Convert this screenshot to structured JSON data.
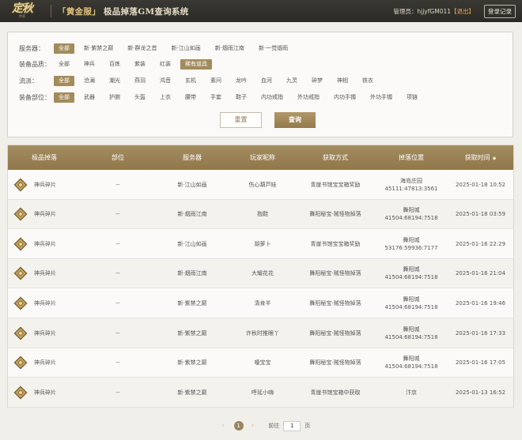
{
  "header": {
    "logo_main": "定秋",
    "logo_sub": "传奇",
    "title_bracket_open": "「",
    "title_server": "黄金服",
    "title_bracket_close": "」",
    "title_text": "极品掉落GM查询系统",
    "admin_label": "管理员：hjjyfGM011",
    "logout_label": "【退出】",
    "login_log_label": "登录记录"
  },
  "filters": {
    "server": {
      "label": "服务器：",
      "options": [
        "全部",
        "新·紫禁之巅",
        "新·群龙之首",
        "新·江山如画",
        "新·烟雨江南",
        "新·一觉烟雨"
      ],
      "active": 0
    },
    "quality": {
      "label": "装备品质：",
      "options": [
        "全部",
        "神兵",
        "百炼",
        "紫装",
        "红装",
        "稀有道具"
      ],
      "active": 5
    },
    "school": {
      "label": "流派：",
      "options": [
        "全部",
        "沧澜",
        "潮光",
        "燕羽",
        "鸿音",
        "玄机",
        "素问",
        "龙吟",
        "血河",
        "九灵",
        "碎梦",
        "神相",
        "铁衣"
      ],
      "active": 0
    },
    "slot": {
      "label": "装备部位：",
      "options": [
        "全部",
        "武器",
        "护腕",
        "头盔",
        "上衣",
        "腰带",
        "手套",
        "鞋子",
        "内功戒指",
        "外功戒指",
        "内功手镯",
        "外功手镯",
        "项链"
      ],
      "active": 0
    },
    "reset_label": "重置",
    "query_label": "查询"
  },
  "table": {
    "columns": [
      "极品掉落",
      "部位",
      "服务器",
      "玩家昵称",
      "获取方式",
      "掉落位置",
      "获取时间"
    ],
    "rows": [
      {
        "item": "神兵碎片",
        "slot": "--",
        "server": "新·江山如画",
        "player": "伤心葫芦娃",
        "method": "青崖书馆宝宝箱奖励",
        "loc1": "海岛庄园",
        "loc2": "45111:47813:3561",
        "time": "2025-01-18 10:52"
      },
      {
        "item": "神兵碎片",
        "slot": "--",
        "server": "新·烟雨江南",
        "player": "抱鞋",
        "method": "舞阳秘宝·贼怪物掉落",
        "loc1": "舞阳城",
        "loc2": "41504:68194:7518",
        "time": "2025-01-18 03:59"
      },
      {
        "item": "神兵碎片",
        "slot": "--",
        "server": "新·江山如画",
        "player": "胡萝卜",
        "method": "青崖书馆宝宝箱奖励",
        "loc1": "舞阳城",
        "loc2": "53176:59936:7177",
        "time": "2025-01-16 22:29"
      },
      {
        "item": "神兵碎片",
        "slot": "--",
        "server": "新·烟雨江南",
        "player": "大耀花花",
        "method": "舞阳秘宝·贼怪物掉落",
        "loc1": "舞阳城",
        "loc2": "41504:68194:7518",
        "time": "2025-01-16 21:04"
      },
      {
        "item": "神兵碎片",
        "slot": "--",
        "server": "新·紫禁之巅",
        "player": "清肯半",
        "method": "舞阳秘宝·贼怪物掉落",
        "loc1": "舞阳城",
        "loc2": "41504:68194:7518",
        "time": "2025-01-16 19:46"
      },
      {
        "item": "神兵碎片",
        "slot": "--",
        "server": "新·紫禁之巅",
        "player": "许秋时推眼丫",
        "method": "舞阳秘宝·贼怪物掉落",
        "loc1": "舞阳城",
        "loc2": "41504:68194:7518",
        "time": "2025-01-16 17:33"
      },
      {
        "item": "神兵碎片",
        "slot": "--",
        "server": "新·紫禁之巅",
        "player": "嗄宝宝",
        "method": "舞阳秘宝·贼怪物掉落",
        "loc1": "舞阳城",
        "loc2": "41504:68194:7518",
        "time": "2025-01-16 17:05"
      },
      {
        "item": "神兵碎片",
        "slot": "--",
        "server": "新·紫禁之巅",
        "player": "呼延小嗨",
        "method": "青崖书馆宝箱中获取",
        "loc1": "汴京",
        "loc2": "",
        "time": "2025-01-13 16:52"
      }
    ]
  },
  "pagination": {
    "prev": "‹",
    "current": "1",
    "next": "›",
    "goto_label": "前往",
    "goto_value": "1",
    "unit": "页"
  },
  "colors": {
    "accent": "#a38b5c",
    "topbar": "#2e2d29",
    "logout": "#e3b04a"
  }
}
